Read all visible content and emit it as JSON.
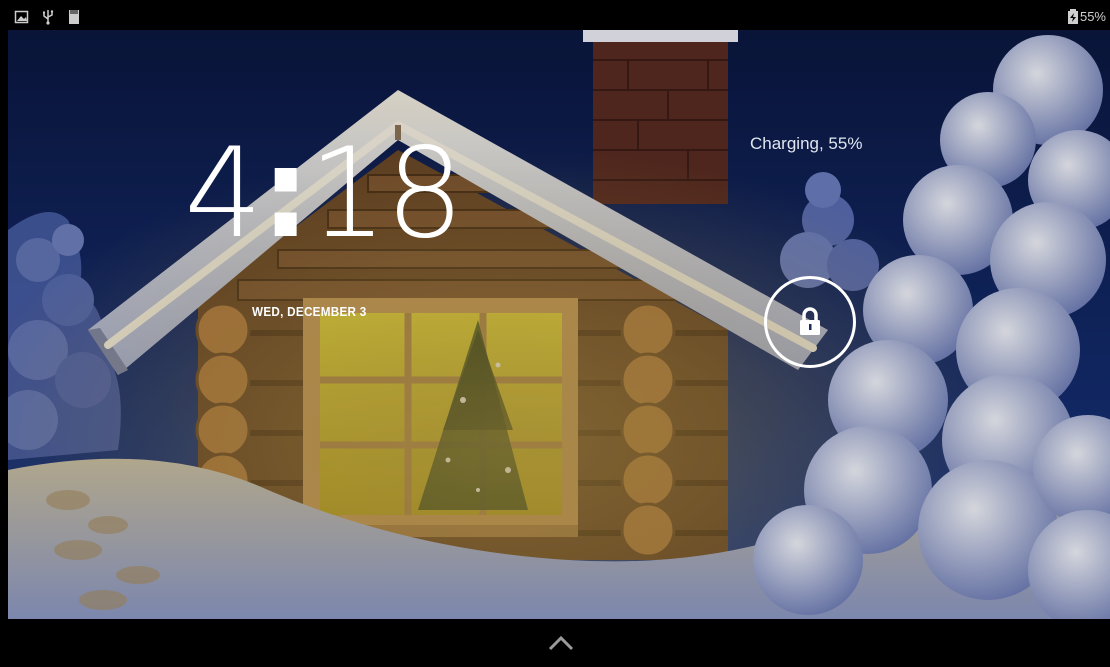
{
  "status_bar": {
    "left_icons": [
      "screenshot-icon",
      "usb-icon",
      "sd-card-icon"
    ],
    "battery_icon": "battery-charging-icon",
    "battery_percent": "55%"
  },
  "lockscreen": {
    "time_hours": "4",
    "time_minutes": "18",
    "time_separator": ":",
    "date": "WED, DECEMBER 3",
    "charging_status": "Charging, 55%",
    "unlock_icon": "lock-icon"
  },
  "nav_bar": {
    "icon": "chevron-up-icon"
  },
  "colors": {
    "sky_top": "#0a1a4a",
    "snow": "#e8ecf7",
    "window_glow": "#d8c93a"
  }
}
